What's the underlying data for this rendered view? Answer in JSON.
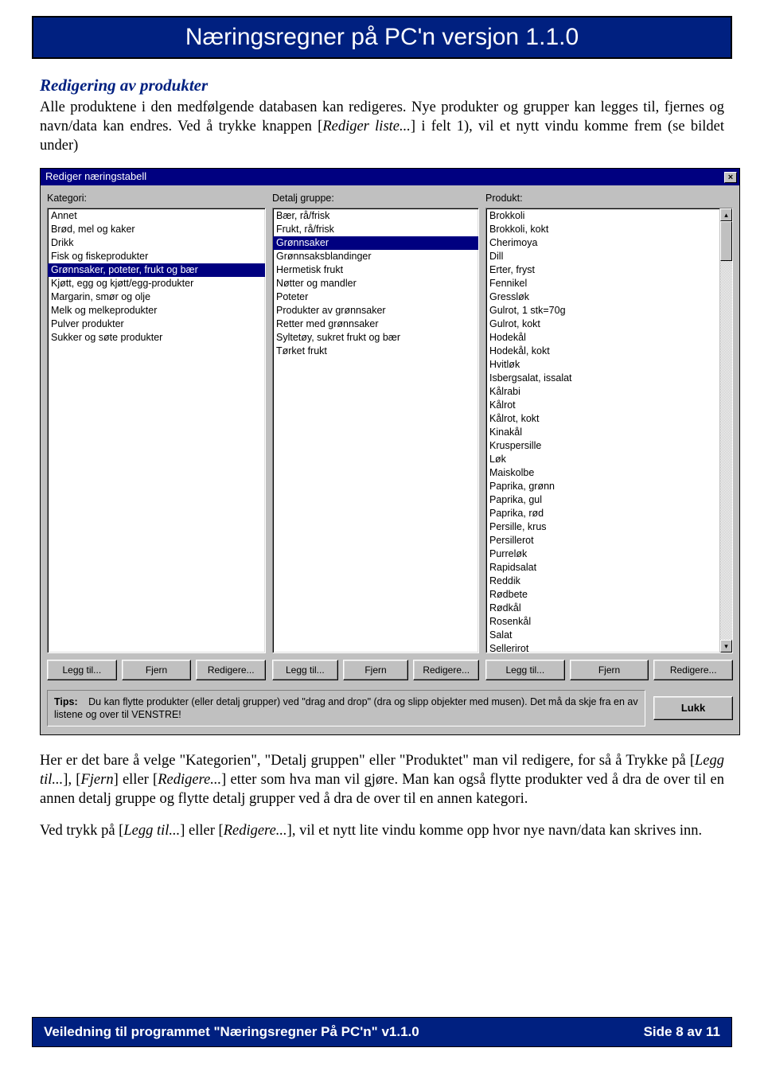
{
  "header": {
    "title": "Næringsregner på PC'n versjon 1.1.0"
  },
  "section": {
    "heading": "Redigering av produkter",
    "para1_a": "Alle produktene i den medfølgende databasen kan redigeres. Nye produkter og grupper kan legges til, fjernes og navn/data kan endres. Ved å trykke knappen [",
    "para1_i": "Rediger liste...",
    "para1_b": "] i felt 1), vil et nytt vindu komme frem (se bildet under)"
  },
  "dialog": {
    "title": "Rediger næringstabell",
    "close": "×",
    "kategori_label": "Kategori:",
    "detalj_label": "Detalj gruppe:",
    "produkt_label": "Produkt:",
    "kategori_items": [
      "Annet",
      "Brød, mel og kaker",
      "Drikk",
      "Fisk og fiskeprodukter",
      "Grønnsaker, poteter, frukt og bær",
      "Kjøtt, egg og kjøtt/egg-produkter",
      "Margarin, smør og olje",
      "Melk og melkeprodukter",
      "Pulver produkter",
      "Sukker og søte produkter"
    ],
    "kategori_selected": 4,
    "detalj_items": [
      "Bær, rå/frisk",
      "Frukt, rå/frisk",
      "Grønnsaker",
      "Grønnsaksblandinger",
      "Hermetisk frukt",
      "Nøtter og mandler",
      "Poteter",
      "Produkter av grønnsaker",
      "Retter med grønnsaker",
      "Syltetøy, sukret frukt og bær",
      "Tørket frukt"
    ],
    "detalj_selected": 2,
    "produkt_items": [
      "Brokkoli",
      "Brokkoli, kokt",
      "Cherimoya",
      "Dill",
      "Erter, fryst",
      "Fennikel",
      "Gressløk",
      "Gulrot, 1 stk=70g",
      "Gulrot, kokt",
      "Hodekål",
      "Hodekål, kokt",
      "Hvitløk",
      "Isbergsalat, issalat",
      "Kålrabi",
      "Kålrot",
      "Kålrot, kokt",
      "Kinakål",
      "Kruspersille",
      "Løk",
      "Maiskolbe",
      "Paprika, grønn",
      "Paprika, gul",
      "Paprika, rød",
      "Persille, krus",
      "Persillerot",
      "Purreløk",
      "Rapidsalat",
      "Reddik",
      "Rødbete",
      "Rødkål",
      "Rosenkål",
      "Salat",
      "Sellerirot"
    ],
    "buttons": {
      "add": "Legg til...",
      "remove": "Fjern",
      "edit": "Redigere..."
    },
    "tips_label": "Tips:",
    "tips_text": "Du kan flytte produkter (eller detalj grupper) ved \"drag and drop\" (dra og slipp objekter med musen). Det må da skje fra en av listene og over til VENSTRE!",
    "lukk": "Lukk",
    "scroll_up": "▴",
    "scroll_down": "▾"
  },
  "para2": {
    "a": "Her er det bare å velge \"Kategorien\", \"Detalj gruppen\" eller \"Produktet\" man vil redigere, for så å Trykke på [",
    "i1": "Legg til...",
    "b": "], [",
    "i2": "Fjern",
    "c": "] eller [",
    "i3": "Redigere...",
    "d": "] etter som hva man vil gjøre. Man kan også flytte produkter ved å dra de over til en annen detalj gruppe og flytte detalj grupper ved å dra de over til en annen kategori."
  },
  "para3": {
    "a": "Ved trykk på [",
    "i1": "Legg til...",
    "b": "] eller [",
    "i2": "Redigere...",
    "c": "], vil et nytt lite vindu komme opp hvor nye navn/data kan skrives inn."
  },
  "footer": {
    "left": "Veiledning til programmet \"Næringsregner På PC'n\" v1.1.0",
    "right": "Side 8 av 11"
  }
}
